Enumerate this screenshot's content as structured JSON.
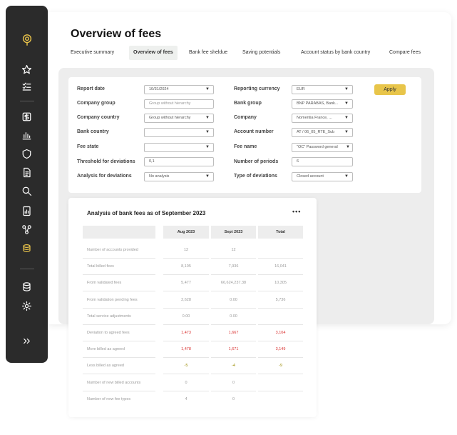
{
  "title": "Overview of fees",
  "tabs": [
    {
      "label": "Executive summary"
    },
    {
      "label": "Overview of fees"
    },
    {
      "label": "Bank fee sheldue"
    },
    {
      "label": "Saving potentials"
    },
    {
      "label": "Account status by bank country"
    },
    {
      "label": "Compare fees"
    }
  ],
  "filters": {
    "report_date": {
      "label": "Report date",
      "value": "10/31/2024"
    },
    "company_group": {
      "label": "Company group",
      "placeholder": "Group without hierarchy"
    },
    "company_country": {
      "label": "Company country",
      "value": "Group without hierarchy"
    },
    "bank_country": {
      "label": "Bank country",
      "value": ""
    },
    "fee_state": {
      "label": "Fee state",
      "value": ""
    },
    "threshold": {
      "label": "Threshold for deviations",
      "value": "0,1"
    },
    "analysis_for_deviations": {
      "label": "Analysis for deviations",
      "value": "No analysis"
    },
    "reporting_currency": {
      "label": "Reporting currency",
      "value": "EUR"
    },
    "bank_group": {
      "label": "Bank group",
      "value": "BNP PARABAS, Bank..."
    },
    "company": {
      "label": "Company",
      "value": "Nomentia France, ..."
    },
    "account_number": {
      "label": "Account number",
      "value": "AT / 06_05_RTE_Sub"
    },
    "fee_name": {
      "label": "Fee name",
      "value": "\"OC\" Password general"
    },
    "number_of_periods": {
      "label": "Number of periods",
      "value": "6"
    },
    "type_of_deviations": {
      "label": "Type of deviations",
      "value": "Closed account"
    },
    "apply_label": "Apply",
    "caret": "▼"
  },
  "analysis": {
    "title": "Analysis of bank fees as of September 2023",
    "more": "•••",
    "columns": [
      "Aug 2023",
      "Sept 2023",
      "Total"
    ],
    "rows": [
      {
        "label": "Number of accounts provided",
        "values": [
          "12",
          "12",
          ""
        ],
        "tone": "gray"
      },
      {
        "label": "Total billed fees",
        "values": [
          "8,105",
          "7,936",
          "16,041"
        ],
        "tone": "gray"
      },
      {
        "label": "From validated fees",
        "values": [
          "5,477",
          "66,624,237.38",
          "10,305"
        ],
        "tone": "gray"
      },
      {
        "label": "From validation pending fees",
        "values": [
          "2,628",
          "0.00",
          "5,736"
        ],
        "tone": "gray"
      },
      {
        "label": "Total service adjustments",
        "values": [
          "0.00",
          "0.00",
          ""
        ],
        "tone": "gray"
      },
      {
        "label": "Deviation to agreed fees",
        "values": [
          "1,473",
          "1,667",
          "3,104"
        ],
        "tone": "red"
      },
      {
        "label": "More billed as agreed",
        "values": [
          "1,478",
          "1,671",
          "3,149"
        ],
        "tone": "red"
      },
      {
        "label": "Less billed as agreed",
        "values": [
          "-5",
          "-4",
          "-9"
        ],
        "tone": "olive"
      },
      {
        "label": "Number of new billed accounts",
        "values": [
          "0",
          "0",
          ""
        ],
        "tone": "gray"
      },
      {
        "label": "Number of new fee types",
        "values": [
          "4",
          "0",
          ""
        ],
        "tone": "gray"
      }
    ]
  },
  "sidebar": {
    "icons": [
      "logo-icon",
      "star-icon",
      "checklist-icon",
      "currency-icon",
      "bar-chart-icon",
      "shield-icon",
      "document-icon",
      "search-icon",
      "report-icon",
      "flow-icon",
      "coins-icon",
      "database-icon",
      "settings-icon",
      "expand-icon"
    ]
  },
  "colors": {
    "accent": "#e8c54a",
    "sidebar": "#2b2b2b",
    "red": "#d9302f",
    "olive": "#9a8a00"
  }
}
